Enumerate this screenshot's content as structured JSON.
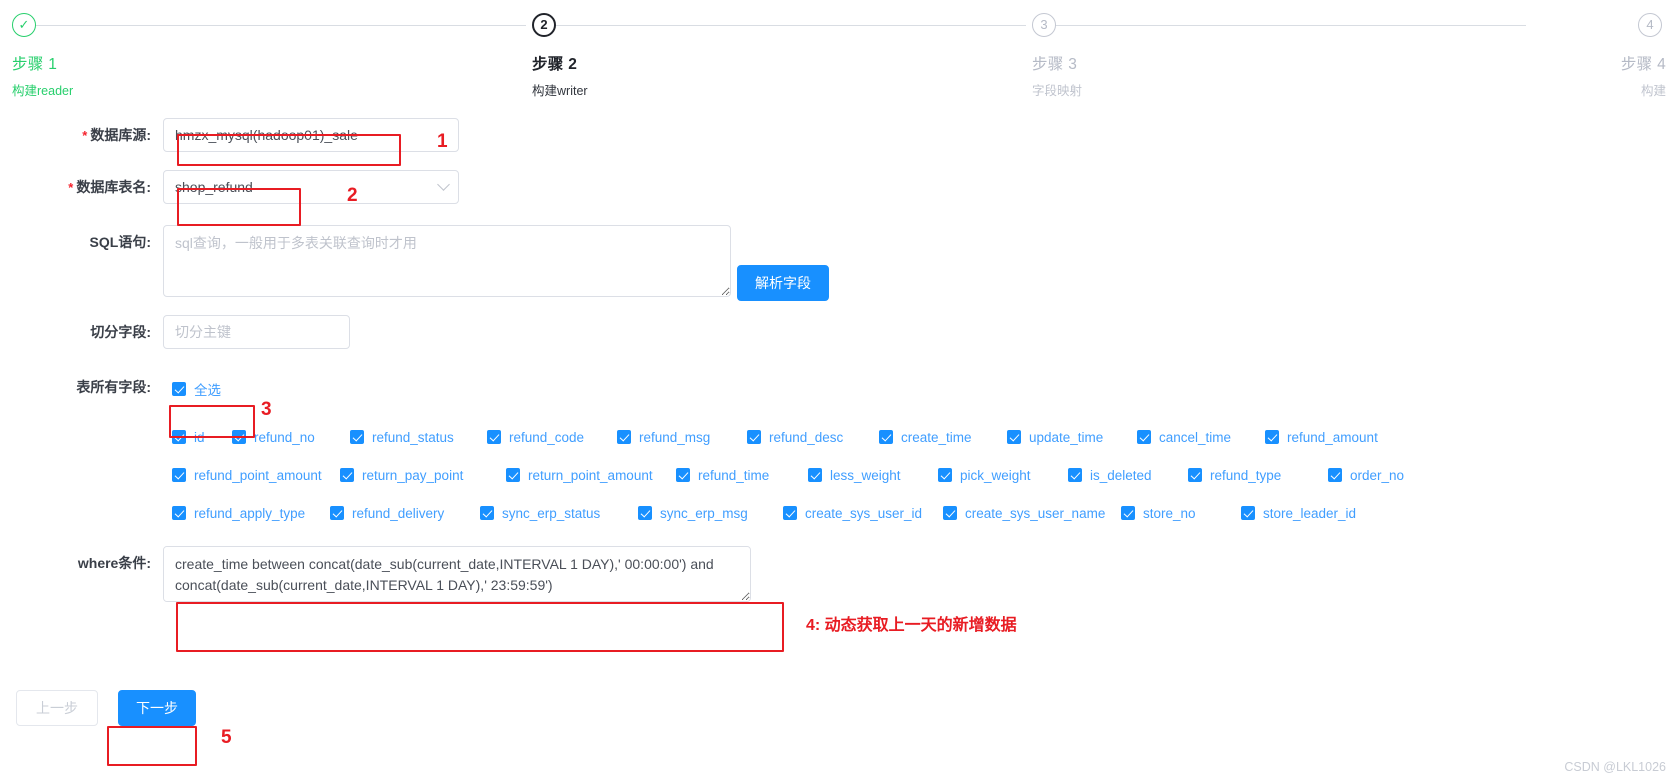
{
  "stepper": {
    "steps": [
      {
        "num": "1",
        "title": "步骤 1",
        "desc": "构建reader",
        "state": "done"
      },
      {
        "num": "2",
        "title": "步骤 2",
        "desc": "构建writer",
        "state": "active"
      },
      {
        "num": "3",
        "title": "步骤 3",
        "desc": "字段映射",
        "state": "wait"
      },
      {
        "num": "4",
        "title": "步骤 4",
        "desc": "构建",
        "state": "wait"
      }
    ]
  },
  "form": {
    "datasource": {
      "label": "数据库源:",
      "required": true,
      "value": "hmzx_mysql(hadoop01)_sale"
    },
    "table": {
      "label": "数据库表名:",
      "required": true,
      "value": "shop_refund"
    },
    "sql": {
      "label": "SQL语句:",
      "value": "",
      "placeholder": "sql查询，一般用于多表关联查询时才用"
    },
    "parse_button": "解析字段",
    "split_field": {
      "label": "切分字段:",
      "value": "",
      "placeholder": "切分主键"
    },
    "all_fields": {
      "label": "表所有字段:",
      "select_all_label": "全选",
      "select_all_checked": true,
      "rows": [
        [
          "id",
          "refund_no",
          "refund_status",
          "refund_code",
          "refund_msg",
          "refund_desc",
          "create_time",
          "update_time",
          "cancel_time",
          "refund_amount"
        ],
        [
          "refund_point_amount",
          "return_pay_point",
          "return_point_amount",
          "refund_time",
          "less_weight",
          "pick_weight",
          "is_deleted",
          "refund_type",
          "order_no"
        ],
        [
          "refund_apply_type",
          "refund_delivery",
          "sync_erp_status",
          "sync_erp_msg",
          "create_sys_user_id",
          "create_sys_user_name",
          "store_no",
          "store_leader_id"
        ]
      ]
    },
    "where": {
      "label": "where条件:",
      "value": "create_time between concat(date_sub(current_date,INTERVAL 1 DAY),' 00:00:00') and concat(date_sub(current_date,INTERVAL 1 DAY),' 23:59:59')"
    }
  },
  "footer": {
    "prev_label": "上一步",
    "next_label": "下一步"
  },
  "annotations": {
    "n1": "1",
    "n2": "2",
    "n3": "3",
    "n4": "4: 动态获取上一天的新增数据",
    "n5": "5"
  },
  "watermark": "CSDN @LKL1026",
  "colors": {
    "primary": "#1890ff",
    "done": "#27cf6c",
    "annotation": "#e81c23",
    "required": "#f5222d"
  }
}
